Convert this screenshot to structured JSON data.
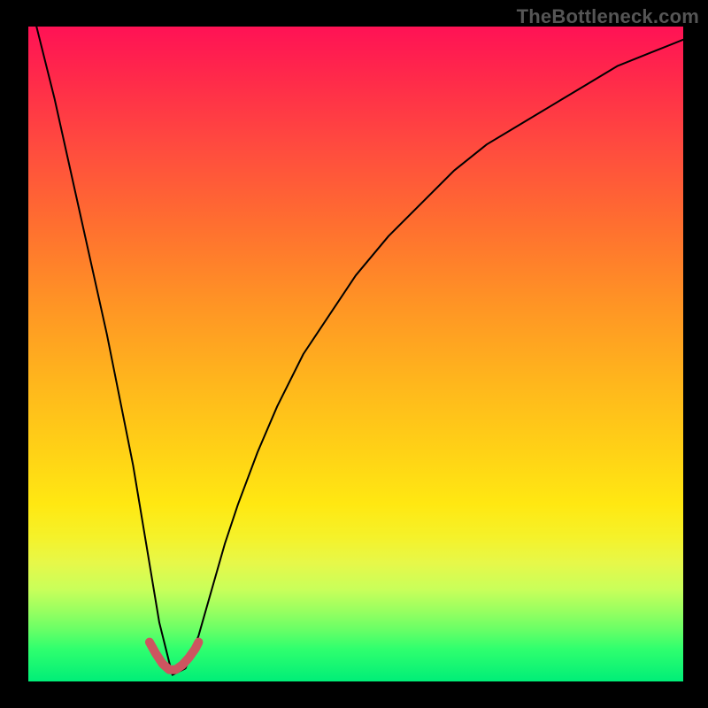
{
  "watermark": "TheBottleneck.com",
  "chart_data": {
    "type": "line",
    "title": "",
    "xlabel": "",
    "ylabel": "",
    "xlim": [
      0,
      100
    ],
    "ylim": [
      0,
      100
    ],
    "grid": false,
    "legend": false,
    "notch_x": 22,
    "highlight_range_x": [
      18.5,
      26
    ],
    "background_gradient_stops": [
      {
        "pos": 0,
        "color": "#ff1255"
      },
      {
        "pos": 0.5,
        "color": "#ffb81c"
      },
      {
        "pos": 0.78,
        "color": "#f5f22a"
      },
      {
        "pos": 1.0,
        "color": "#00ee78"
      }
    ],
    "series": [
      {
        "name": "bottleneck-curve",
        "x": [
          0,
          2,
          4,
          6,
          8,
          10,
          12,
          14,
          16,
          18,
          20,
          22,
          24,
          26,
          28,
          30,
          32,
          35,
          38,
          42,
          46,
          50,
          55,
          60,
          65,
          70,
          75,
          80,
          85,
          90,
          95,
          100
        ],
        "y": [
          105,
          97,
          89,
          80,
          71,
          62,
          53,
          43,
          33,
          21,
          9,
          1,
          2,
          7,
          14,
          21,
          27,
          35,
          42,
          50,
          56,
          62,
          68,
          73,
          78,
          82,
          85,
          88,
          91,
          94,
          96,
          98
        ]
      }
    ],
    "highlight_points": {
      "x": [
        18.5,
        19.5,
        20.5,
        21.5,
        22.5,
        23.5,
        24.5,
        25.5,
        26.0
      ],
      "y": [
        6.0,
        4.2,
        2.7,
        1.8,
        1.8,
        2.5,
        3.6,
        5.0,
        6.0
      ]
    }
  }
}
